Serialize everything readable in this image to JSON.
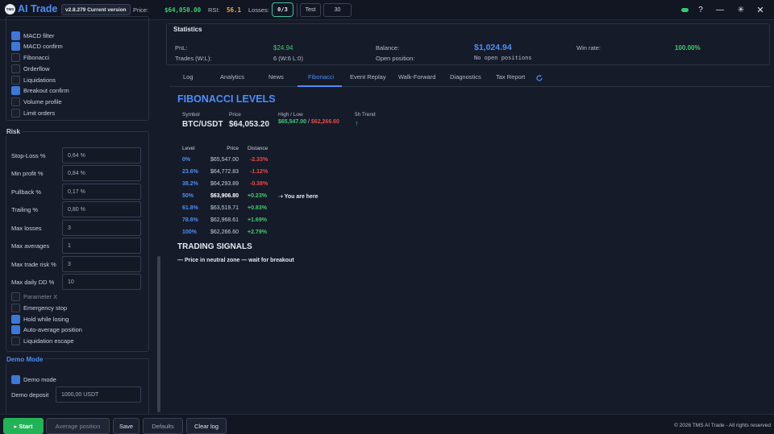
{
  "app": {
    "logo_text": "TMS",
    "name": "AI Trade",
    "version": "v2.8.279 Current version"
  },
  "topbar": {
    "price_label": "Price:",
    "price_value": "$64,050.00",
    "rsi_label": "RSI:",
    "rsi_value": "56.1",
    "losses_label": "Losses:",
    "losses_value": "0/3",
    "test_label": "Test",
    "number_value": "30",
    "help": "?",
    "minimize": "—",
    "maximize": "✳",
    "close": "✕"
  },
  "colors": {
    "accent": "#4d8ef8",
    "positive": "#3bcf6f",
    "negative": "#ec4a4a",
    "start_button": "#22b357"
  },
  "sidebar": {
    "filters": [
      {
        "label": "MACD filter",
        "checked": true
      },
      {
        "label": "MACD confirm",
        "checked": true
      },
      {
        "label": "Fibonacci",
        "checked": false
      },
      {
        "label": "Orderflow",
        "checked": false
      },
      {
        "label": "Liquidations",
        "checked": false
      },
      {
        "label": "Breakout confirm",
        "checked": true
      },
      {
        "label": "Volume profile",
        "checked": false
      },
      {
        "label": "Limit orders",
        "checked": false
      }
    ],
    "risk": {
      "title": "Risk",
      "fields": [
        {
          "label": "Stop-Loss %",
          "value": "0,64 %"
        },
        {
          "label": "Min profit %",
          "value": "0,84 %"
        },
        {
          "label": "Pullback %",
          "value": "0,17 %"
        },
        {
          "label": "Trailing %",
          "value": "0,80 %"
        },
        {
          "label": "Max losses",
          "value": "3"
        },
        {
          "label": "Max averages",
          "value": "1"
        },
        {
          "label": "Max trade risk %",
          "value": "3"
        },
        {
          "label": "Max daily DD %",
          "value": "10"
        }
      ],
      "options": [
        {
          "label": "Parameter X",
          "checked": false,
          "dim": true
        },
        {
          "label": "Emergency stop",
          "checked": false
        },
        {
          "label": "Hold while losing",
          "checked": true
        },
        {
          "label": "Auto-average position",
          "checked": true
        },
        {
          "label": "Liquidation escape",
          "checked": false
        }
      ]
    },
    "demo": {
      "title": "Demo Mode",
      "mode_label": "Demo mode",
      "mode_checked": true,
      "deposit_label": "Demo deposit",
      "deposit_value": "1000,00 USDT"
    }
  },
  "statistics": {
    "title": "Statistics",
    "pnl_label": "PnL:",
    "pnl_value": "$24.94",
    "trades_label": "Trades (W:L):",
    "trades_value": "6 (W:6 L:0)",
    "balance_label": "Balance:",
    "balance_value": "$1,024.94",
    "open_position_label": "Open position:",
    "open_position_value": "No open positions",
    "winrate_label": "Win rate:",
    "winrate_value": "100.00%"
  },
  "tabs": [
    {
      "label": "Log"
    },
    {
      "label": "Analytics"
    },
    {
      "label": "News"
    },
    {
      "label": "Fibonacci",
      "active": true
    },
    {
      "label": "Event Replay"
    },
    {
      "label": "Walk-Forward"
    },
    {
      "label": "Diagnostics"
    },
    {
      "label": "Tax Report"
    }
  ],
  "fibonacci": {
    "title": "FIBONACCI LEVELS",
    "symbol_label": "Symbol",
    "symbol_value": "BTC/USDT",
    "price_label": "Price",
    "price_value": "$64,053.20",
    "highlow_label": "High / Low",
    "high_value": "$65,547.00",
    "separator": "/",
    "low_value": "$62,266.60",
    "trend_label": "5h Trend",
    "trend_value": "↑",
    "table": {
      "headers": {
        "level": "Level",
        "price": "Price",
        "distance": "Distance"
      },
      "rows": [
        {
          "level": "0%",
          "price": "$65,547.00",
          "distance": "-2.33%",
          "trend": "neg"
        },
        {
          "level": "23.6%",
          "price": "$64,772.83",
          "distance": "-1.12%",
          "trend": "neg"
        },
        {
          "level": "38.2%",
          "price": "$64,293.89",
          "distance": "-0.38%",
          "trend": "neg"
        },
        {
          "level": "50%",
          "price": "$63,906.80",
          "distance": "+0.23%",
          "trend": "pos",
          "current": true,
          "note": "⇢ You are here"
        },
        {
          "level": "61.8%",
          "price": "$63,519.71",
          "distance": "+0.83%",
          "trend": "pos"
        },
        {
          "level": "78.6%",
          "price": "$62,968.61",
          "distance": "+1.69%",
          "trend": "pos"
        },
        {
          "level": "100%",
          "price": "$62,266.60",
          "distance": "+2.79%",
          "trend": "pos"
        }
      ]
    },
    "signals_title": "TRADING SIGNALS",
    "signal_text": "— Price in neutral zone — wait for breakout"
  },
  "bottombar": {
    "start": "▸ Start",
    "average": "Average position",
    "save": "Save",
    "defaults": "Defaults",
    "clear_log": "Clear log",
    "copyright": "© 2026 TMS AI Trade - All rights reserved"
  }
}
